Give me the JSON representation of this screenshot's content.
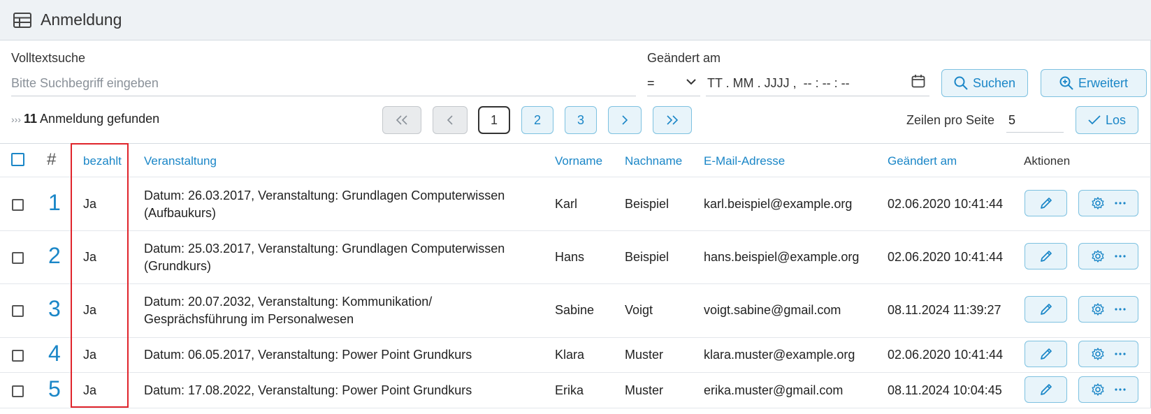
{
  "header": {
    "title": "Anmeldung",
    "icon": "table-icon"
  },
  "search": {
    "label": "Volltextsuche",
    "placeholder": "Bitte Suchbegriff eingeben"
  },
  "date_filter": {
    "label": "Geändert am",
    "operator": "=",
    "placeholder": "TT . MM . JJJJ ,  -- : -- : --"
  },
  "buttons": {
    "search": "Suchen",
    "advanced": "Erweitert",
    "go": "Los"
  },
  "result": {
    "count": "11",
    "text": "Anmeldung gefunden"
  },
  "pagination": {
    "first": "«",
    "prev": "‹",
    "pages": [
      "1",
      "2",
      "3"
    ],
    "next": "›",
    "last": "»",
    "current": "1"
  },
  "rows_per_page": {
    "label": "Zeilen pro Seite",
    "value": "5"
  },
  "columns": {
    "hash": "#",
    "paid": "bezahlt",
    "event": "Veranstaltung",
    "firstname": "Vorname",
    "lastname": "Nachname",
    "email": "E-Mail-Adresse",
    "changed": "Geändert am",
    "actions": "Aktionen"
  },
  "rows": [
    {
      "num": "1",
      "paid": "Ja",
      "event_line1": "Datum: 26.03.2017, Veranstaltung: Grundlagen Computerwissen",
      "event_line2": "(Aufbaukurs)",
      "firstname": "Karl",
      "lastname": "Beispiel",
      "email": "karl.beispiel@example.org",
      "changed": "02.06.2020 10:41:44"
    },
    {
      "num": "2",
      "paid": "Ja",
      "event_line1": "Datum: 25.03.2017, Veranstaltung: Grundlagen Computerwissen",
      "event_line2": "(Grundkurs)",
      "firstname": "Hans",
      "lastname": "Beispiel",
      "email": "hans.beispiel@example.org",
      "changed": "02.06.2020 10:41:44"
    },
    {
      "num": "3",
      "paid": "Ja",
      "event_line1": "Datum: 20.07.2032, Veranstaltung: Kommunikation/",
      "event_line2": "Gesprächsführung im Personalwesen",
      "firstname": "Sabine",
      "lastname": "Voigt",
      "email": "voigt.sabine@gmail.com",
      "changed": "08.11.2024 11:39:27"
    },
    {
      "num": "4",
      "paid": "Ja",
      "event_line1": "Datum: 06.05.2017, Veranstaltung: Power Point Grundkurs",
      "event_line2": "",
      "firstname": "Klara",
      "lastname": "Muster",
      "email": "klara.muster@example.org",
      "changed": "02.06.2020 10:41:44"
    },
    {
      "num": "5",
      "paid": "Ja",
      "event_line1": "Datum: 17.08.2022, Veranstaltung: Power Point Grundkurs",
      "event_line2": "",
      "firstname": "Erika",
      "lastname": "Muster",
      "email": "erika.muster@gmail.com",
      "changed": "08.11.2024 10:04:45"
    }
  ],
  "colors": {
    "accent": "#1a86c7",
    "highlight": "#e0242b"
  }
}
